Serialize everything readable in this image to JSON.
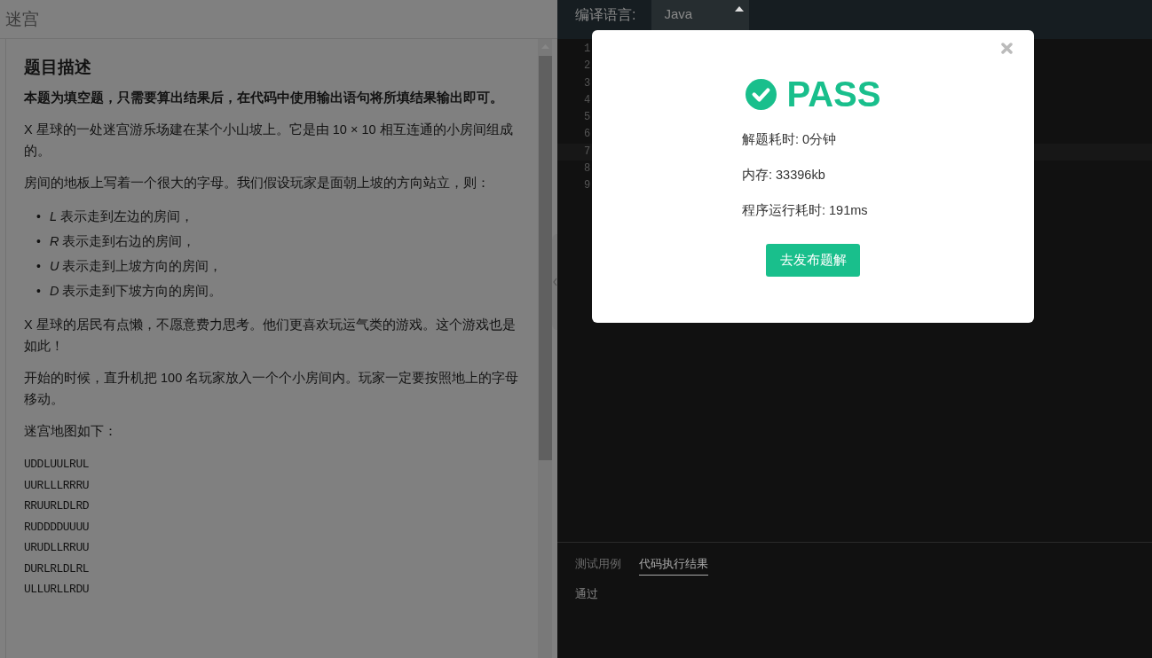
{
  "problem": {
    "title": "迷宫",
    "heading": "题目描述",
    "intro": "本题为填空题，只需要算出结果后，在代码中使用输出语句将所填结果输出即可。",
    "paragraphs_before": [
      "X 星球的一处迷宫游乐场建在某个小山坡上。它是由 10 × 10 相互连通的小房间组成的。",
      "房间的地板上写着一个很大的字母。我们假设玩家是面朝上坡的方向站立，则："
    ],
    "rules": [
      {
        "bullet": "•",
        "text": "*L* 表示走到左边的房间，"
      },
      {
        "bullet": "•",
        "text": "*R* 表示走到右边的房间，"
      },
      {
        "bullet": "•",
        "text": "*U* 表示走到上坡方向的房间，"
      },
      {
        "bullet": "•",
        "text": "*D* 表示走到下坡方向的房间。"
      }
    ],
    "paragraphs_after": [
      "X 星球的居民有点懒，不愿意费力思考。他们更喜欢玩运气类的游戏。这个游戏也是如此！",
      "开始的时候，直升机把 100 名玩家放入一个个小房间内。玩家一定要按照地上的字母移动。",
      "迷宫地图如下："
    ],
    "maze_rows": [
      "UDDLUULRUL",
      "UURLLLRRRU",
      "RRUURLDLRD",
      "RUDDDDUUUU",
      "URUDLLRRUU",
      "DURLRLDLRL",
      "ULLURLLRDU"
    ]
  },
  "editor": {
    "language_label": "编译语言:",
    "language": "Java",
    "line_numbers": [
      "1",
      "2",
      "3",
      "4",
      "5",
      "6",
      "7",
      "8",
      "9"
    ]
  },
  "result_tabs": [
    {
      "label": "测试用例",
      "selected": false
    },
    {
      "label": "代码执行结果",
      "selected": true
    }
  ],
  "result_text": "通过",
  "dialog": {
    "status": "PASS",
    "stats": [
      "解题耗时: 0分钟",
      "内存: 33396kb",
      "程序运行耗时: 191ms"
    ],
    "button": "去发布题解"
  }
}
